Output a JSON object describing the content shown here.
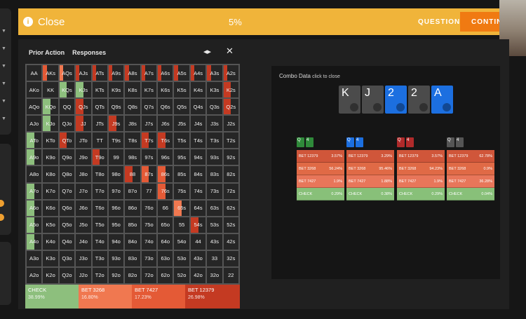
{
  "topbar": {
    "close_label": "Close",
    "close_icon": "info",
    "progress": "5%",
    "question_label": "QUESTION",
    "continue_label": "CONTIN"
  },
  "grid_header": {
    "prior_action": "Prior Action",
    "responses": "Responses"
  },
  "colors": {
    "check": "#8dbf7d",
    "bet3268": "#f07850",
    "bet7427": "#e45a36",
    "bet12379": "#c43a22",
    "accent": "#f0b43a"
  },
  "hands": [
    [
      "AA",
      "AKs",
      "AQs",
      "AJs",
      "ATs",
      "A9s",
      "A8s",
      "A7s",
      "A6s",
      "A5s",
      "A4s",
      "A3s",
      "A2s"
    ],
    [
      "AKo",
      "KK",
      "KQs",
      "KJs",
      "KTs",
      "K9s",
      "K8s",
      "K7s",
      "K6s",
      "K5s",
      "K4s",
      "K3s",
      "K2s"
    ],
    [
      "AQo",
      "KQo",
      "QQ",
      "QJs",
      "QTs",
      "Q9s",
      "Q8s",
      "Q7s",
      "Q6s",
      "Q5s",
      "Q4s",
      "Q3s",
      "Q2s"
    ],
    [
      "AJo",
      "KJo",
      "QJo",
      "JJ",
      "JTs",
      "J9s",
      "J8s",
      "J7s",
      "J6s",
      "J5s",
      "J4s",
      "J3s",
      "J2s"
    ],
    [
      "ATo",
      "KTo",
      "QTo",
      "JTo",
      "TT",
      "T9s",
      "T8s",
      "T7s",
      "T6s",
      "T5s",
      "T4s",
      "T3s",
      "T2s"
    ],
    [
      "A9o",
      "K9o",
      "Q9o",
      "J9o",
      "T9o",
      "99",
      "98s",
      "97s",
      "96s",
      "95s",
      "94s",
      "93s",
      "92s"
    ],
    [
      "A8o",
      "K8o",
      "Q8o",
      "J8o",
      "T8o",
      "98o",
      "88",
      "87s",
      "86s",
      "85s",
      "84s",
      "83s",
      "82s"
    ],
    [
      "A7o",
      "K7o",
      "Q7o",
      "J7o",
      "T7o",
      "97o",
      "87o",
      "77",
      "76s",
      "75s",
      "74s",
      "73s",
      "72s"
    ],
    [
      "A6o",
      "K6o",
      "Q6o",
      "J6o",
      "T6o",
      "96o",
      "86o",
      "76o",
      "66",
      "65s",
      "64s",
      "63s",
      "62s"
    ],
    [
      "A5o",
      "K5o",
      "Q5o",
      "J5o",
      "T5o",
      "95o",
      "85o",
      "75o",
      "65o",
      "55",
      "54s",
      "53s",
      "52s"
    ],
    [
      "A4o",
      "K4o",
      "Q4o",
      "J4o",
      "T4o",
      "94o",
      "84o",
      "74o",
      "64o",
      "54o",
      "44",
      "43s",
      "42s"
    ],
    [
      "A3o",
      "K3o",
      "Q3o",
      "J3o",
      "T3o",
      "93o",
      "83o",
      "73o",
      "63o",
      "53o",
      "43o",
      "33",
      "32s"
    ],
    [
      "A2o",
      "K2o",
      "Q2o",
      "J2o",
      "T2o",
      "92o",
      "82o",
      "72o",
      "62o",
      "52o",
      "42o",
      "32o",
      "22"
    ]
  ],
  "summary": [
    {
      "label": "CHECK",
      "pct": "38.99%",
      "color": "#8dbf7d"
    },
    {
      "label": "BET 3268",
      "pct": "16.80%",
      "color": "#f07850"
    },
    {
      "label": "BET 7427",
      "pct": "17.23%",
      "color": "#e45a36"
    },
    {
      "label": "BET 12379",
      "pct": "26.98%",
      "color": "#c43a22"
    }
  ],
  "combo": {
    "title": "Combo Data",
    "subtitle": "click to close",
    "board": [
      {
        "rank": "K",
        "color": "#4b4b4b"
      },
      {
        "rank": "J",
        "color": "#4b4b4b"
      },
      {
        "rank": "2",
        "color": "#1c6fe0"
      },
      {
        "rank": "2",
        "color": "#4b4b4b"
      },
      {
        "rank": "A",
        "color": "#1c6fe0"
      }
    ],
    "tables": [
      {
        "cards": [
          {
            "r": "Q",
            "c": "#2f8a3a"
          },
          {
            "r": "4",
            "c": "#2f8a3a"
          }
        ],
        "rows": [
          [
            "BET 12379",
            "3.57%"
          ],
          [
            "BET 3268",
            "56.24%"
          ],
          [
            "BET 7427",
            "1.9%"
          ],
          [
            "CHECK",
            "0.29%"
          ]
        ]
      },
      {
        "cards": [
          {
            "r": "Q",
            "c": "#1c6fe0"
          },
          {
            "r": "4",
            "c": "#1c6fe0"
          }
        ],
        "rows": [
          [
            "BET 12379",
            "3.29%"
          ],
          [
            "BET 3268",
            "95.46%"
          ],
          [
            "BET 7427",
            "1.88%"
          ],
          [
            "CHECK",
            "0.38%"
          ]
        ]
      },
      {
        "cards": [
          {
            "r": "Q",
            "c": "#b02a2a"
          },
          {
            "r": "4",
            "c": "#b02a2a"
          }
        ],
        "rows": [
          [
            "BET 12379",
            "3.57%"
          ],
          [
            "BET 3268",
            "94.23%"
          ],
          [
            "BET 7427",
            "1.9%"
          ],
          [
            "CHECK",
            "0.29%"
          ]
        ]
      },
      {
        "cards": [
          {
            "r": "Q",
            "c": "#555555"
          },
          {
            "r": "4",
            "c": "#555555"
          }
        ],
        "rows": [
          [
            "BET 12379",
            "62.78%"
          ],
          [
            "BET 3268",
            "0.9%"
          ],
          [
            "BET 7427",
            "36.28%"
          ],
          [
            "CHECK",
            "0.04%"
          ]
        ]
      }
    ]
  }
}
